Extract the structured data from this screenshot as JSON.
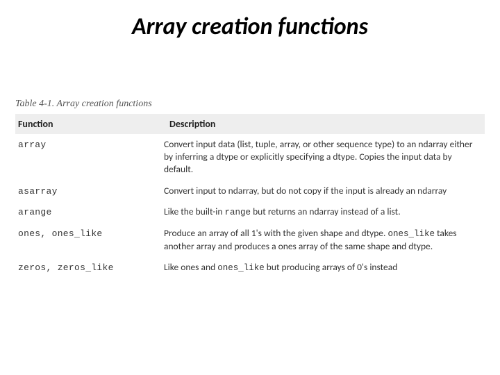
{
  "title": "Array creation functions",
  "caption": "Table 4-1. Array creation functions",
  "columns": {
    "c1": "Function",
    "c2": "Description"
  },
  "rows": [
    {
      "fn": "array",
      "desc": "Convert input data (list, tuple, array, or other sequence type) to an ndarray either by inferring a dtype or explicitly specifying a dtype. Copies the input data by default."
    },
    {
      "fn": "asarray",
      "desc": "Convert input to ndarray, but do not copy if the input is already an ndarray"
    },
    {
      "fn": "arange",
      "desc_pre": "Like the built-in ",
      "code1": "range",
      "desc_post": " but returns an ndarray instead of a list."
    },
    {
      "fn": "ones, ones_like",
      "desc_pre": "Produce an array of all 1's with the given shape and dtype. ",
      "code1": "ones_like",
      "desc_post": " takes another array and produces a ones array of the same shape and dtype."
    },
    {
      "fn": "zeros, zeros_like",
      "desc_pre": "Like ones and ",
      "code1": "ones_like",
      "desc_post": " but producing arrays of 0's instead"
    }
  ]
}
